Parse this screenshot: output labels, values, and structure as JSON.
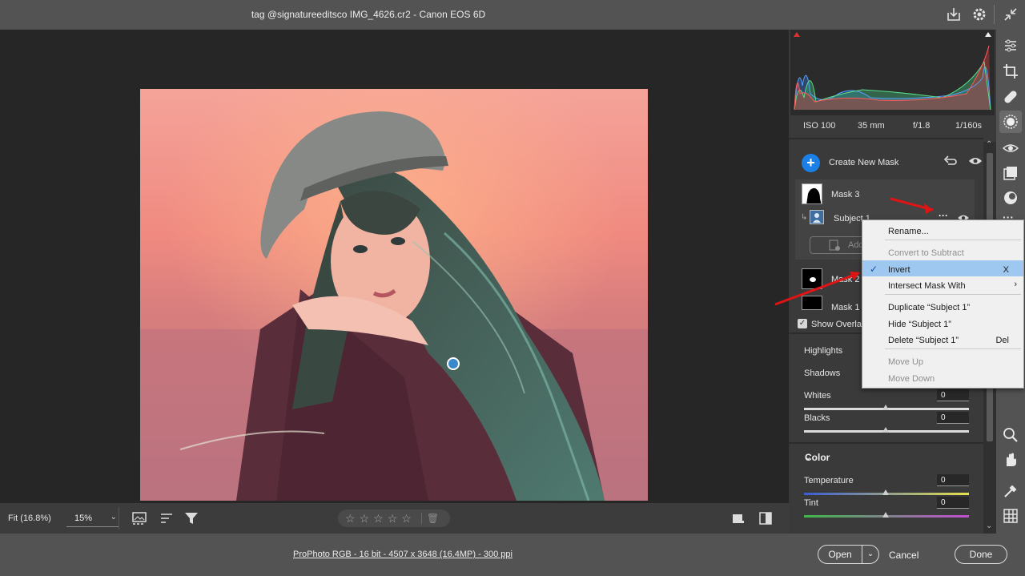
{
  "window": {
    "title": "tag @signatureeditsco IMG_4626.cr2  -  Canon EOS 6D"
  },
  "titlebar_icons": [
    "save-icon",
    "gear-icon",
    "collapse-icon"
  ],
  "exif": {
    "iso": "ISO 100",
    "focal": "35 mm",
    "aperture": "f/1.8",
    "shutter": "1/160s"
  },
  "masks": {
    "create_label": "Create New Mask",
    "items": [
      {
        "name": "Mask 3",
        "component": "Subject 1"
      },
      {
        "name": "Mask 2"
      },
      {
        "name": "Mask 1"
      }
    ],
    "add_label": "Add",
    "show_overlay_label": "Show Overlay",
    "show_overlay_checked": true
  },
  "sliders": [
    {
      "label": "Highlights"
    },
    {
      "label": "Shadows"
    },
    {
      "label": "Whites",
      "value": "0"
    },
    {
      "label": "Blacks",
      "value": "0"
    }
  ],
  "color_section": {
    "title": "Color",
    "sliders": [
      {
        "label": "Temperature",
        "value": "0"
      },
      {
        "label": "Tint",
        "value": "0"
      }
    ]
  },
  "context_menu": {
    "rename": "Rename...",
    "convert": "Convert to Subtract",
    "invert": "Invert",
    "invert_shortcut": "X",
    "intersect": "Intersect Mask With",
    "duplicate": "Duplicate “Subject 1”",
    "hide": "Hide “Subject 1”",
    "delete": "Delete “Subject 1”",
    "delete_shortcut": "Del",
    "move_up": "Move Up",
    "move_down": "Move Down"
  },
  "bottombar": {
    "zoom_fit": "Fit (16.8%)",
    "zoom_pct": "15%",
    "rating_stars": 5
  },
  "footer": {
    "file_info": "ProPhoto RGB - 16 bit - 4507 x 3648 (16.4MP) - 300 ppi",
    "open_label": "Open",
    "cancel_label": "Cancel",
    "done_label": "Done"
  },
  "tools": [
    "edit-sliders-icon",
    "crop-icon",
    "healing-icon",
    "masking-icon",
    "red-eye-icon",
    "presets-icon",
    "snapshots-icon",
    "more-icon",
    "zoom-icon",
    "hand-icon",
    "eyedropper-icon",
    "grid-icon"
  ],
  "colors": {
    "accent": "#1a7fe6",
    "menu_highlight": "#9ec8f0",
    "annotation_arrow": "#e01414"
  }
}
